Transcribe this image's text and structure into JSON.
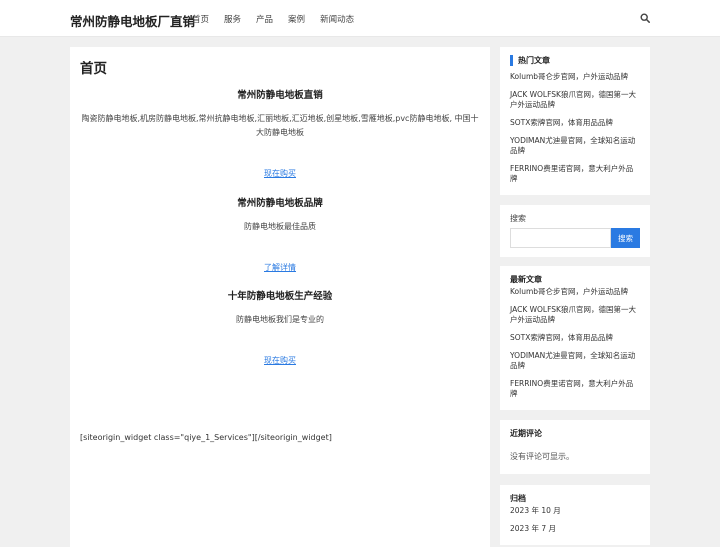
{
  "header": {
    "site_title": "常州防静电地板厂直销",
    "nav": [
      "首页",
      "服务",
      "产品",
      "案例",
      "新闻动态"
    ]
  },
  "main": {
    "page_title": "首页",
    "section1_title": "常州防静电地板直销",
    "section1_text": "陶瓷防静电地板,机房防静电地板,常州抗静电地板,汇丽地板,汇迈地板,创星地板,雪雁地板,pvc防静电地板, 中国十大防静电地板",
    "link1": "现在购买",
    "section2_title": "常州防静电地板品牌",
    "section2_text": "防静电地板最佳品质",
    "link2": "了解详情",
    "section3_title": "十年防静电地板生产经验",
    "section3_text": "防静电地板我们是专业的",
    "link3": "现在购买",
    "shortcode": "[siteorigin_widget class=\"qiye_1_Services\"][/siteorigin_widget]"
  },
  "sidebar": {
    "hot_title": "热门文章",
    "hot_items": [
      "Kolumb哥仑步官网，户外运动品牌",
      "JACK WOLFSK狼爪官网，德国第一大户外运动品牌",
      "SOTX索牌官网，体育用品品牌",
      "YODIMAN尤迪曼官网，全球知名运动品牌",
      "FERRINO费里诺官网，意大利户外品牌"
    ],
    "search_label": "搜索",
    "search_button": "搜索",
    "search_value": "",
    "latest_title": "最新文章",
    "latest_items": [
      "Kolumb哥仑步官网，户外运动品牌",
      "JACK WOLFSK狼爪官网，德国第一大户外运动品牌",
      "SOTX索牌官网，体育用品品牌",
      "YODIMAN尤迪曼官网，全球知名运动品牌",
      "FERRINO费里诺官网，意大利户外品牌"
    ],
    "comments_title": "近期评论",
    "comments_empty": "没有评论可显示。",
    "archive_title": "归档",
    "archive_items": [
      "2023 年 10 月",
      "2023 年 7 月"
    ]
  },
  "colors": {
    "accent": "#2a7ae2",
    "background": "#f0f0f0"
  }
}
